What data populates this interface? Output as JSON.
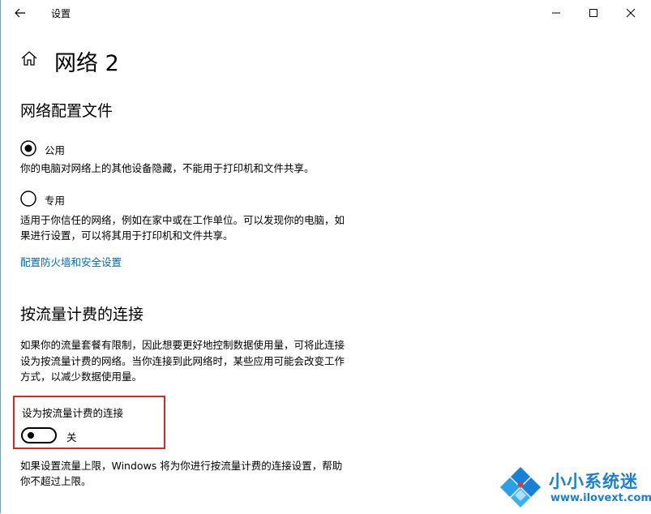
{
  "window": {
    "title": "设置"
  },
  "header": {
    "title": "网络 2"
  },
  "profile": {
    "heading": "网络配置文件",
    "public": {
      "label": "公用",
      "selected": true,
      "description": "你的电脑对网络上的其他设备隐藏，不能用于打印机和文件共享。"
    },
    "private": {
      "label": "专用",
      "selected": false,
      "description_line1": "适用于你信任的网络，例如在家中或在工作单位。可以发现你的电脑，如",
      "description_line2": "果进行设置，可以将其用于打印机和文件共享。"
    },
    "firewall_link": "配置防火墙和安全设置"
  },
  "metered": {
    "heading": "按流量计费的连接",
    "description_line1": "如果你的流量套餐有限制，因此想要更好地控制数据使用量，可将此连接",
    "description_line2": "设为按流量计费的网络。当你连接到此网络时，某些应用可能会改变工作",
    "description_line3": "方式，以减少数据使用量。",
    "toggle_label": "设为按流量计费的连接",
    "toggle_state": "关",
    "toggle_on": false,
    "limit_note_line1": "如果设置流量上限，Windows 将为你进行按流量计费的连接设置，帮助",
    "limit_note_line2": "你不超过上限。"
  },
  "watermark": {
    "name": "小小系统迷",
    "url": "www.ilovext.com"
  },
  "colors": {
    "accent": "#0067b8",
    "highlight": "#d9262a",
    "watermark": "#1a7fd6"
  }
}
